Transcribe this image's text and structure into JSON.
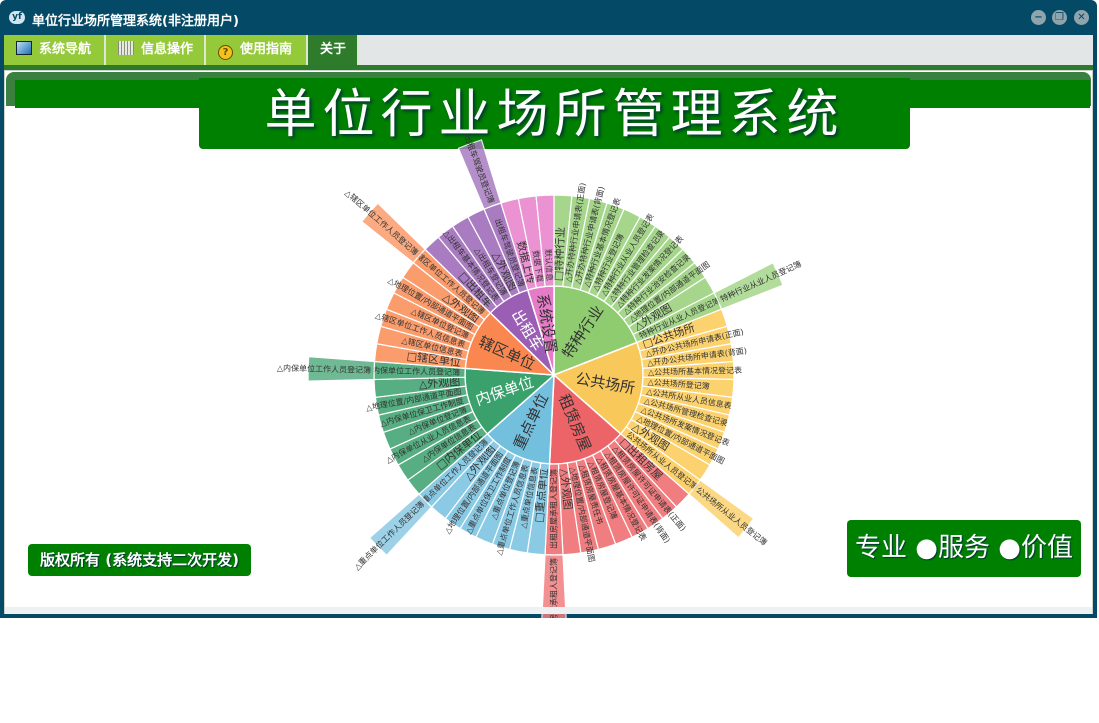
{
  "window": {
    "title": "单位行业场所管理系统(非注册用户)",
    "logo": "yf"
  },
  "menu": [
    {
      "label": "系统导航",
      "icon": "monitor-icon"
    },
    {
      "label": "信息操作",
      "icon": "grid-icon"
    },
    {
      "label": "使用指南",
      "icon": "help-icon"
    },
    {
      "label": "关于",
      "icon": ""
    }
  ],
  "banner": {
    "title": "单位行业场所管理系统"
  },
  "footer": {
    "copyright": "版权所有 (系统支持二次开发)",
    "motto": "专业 ●服务 ●价值"
  },
  "sunburst": [
    {
      "name": "特种行业",
      "color": "#8fcb6f",
      "leaf": "#a5d68b",
      "children": [
        {
          "label": "□特种行业"
        },
        {
          "label": "△开办特种行业申请表(正面)"
        },
        {
          "label": "△开办特种行业申请表(背面)"
        },
        {
          "label": "△特种行业基本情况登记表"
        },
        {
          "label": "△特种行业登记簿"
        },
        {
          "label": "△特种行业从业人员登记表"
        },
        {
          "label": "△特种行业管理检查记录"
        },
        {
          "label": "△特种行业发案情况登记表"
        },
        {
          "label": "△特种行业治安检查记录"
        },
        {
          "label": "△地理位置/内部通道平面图"
        },
        {
          "label": "△外观图"
        },
        {
          "label": "特种行业从业人员登记簿",
          "ext": "特种行业从业人员登记簿"
        }
      ]
    },
    {
      "name": "公共场所",
      "color": "#f9c85a",
      "leaf": "#fbd26e",
      "children": [
        {
          "label": "□公共场所"
        },
        {
          "label": "△开办公共场所申请表(正面)"
        },
        {
          "label": "△开办公共场所申请表(背面)"
        },
        {
          "label": "△公共场所基本情况登记表"
        },
        {
          "label": "△公共场所登记簿"
        },
        {
          "label": "△公共所从业人员信息表"
        },
        {
          "label": "△公共场所管理检查记录"
        },
        {
          "label": "△公共场所发案情况登记表"
        },
        {
          "label": "△地理位置/内部通道平面图"
        },
        {
          "label": "△外观图"
        },
        {
          "label": "公共场所从业人员登记簿",
          "ext": "公共场所从业人员登记簿"
        }
      ]
    },
    {
      "name": "租赁房屋",
      "color": "#ec6467",
      "leaf": "#f07d7f",
      "children": [
        {
          "label": "□出租房屋"
        },
        {
          "label": "△租赁房屋许可证申请表(正面)"
        },
        {
          "label": "△租赁房屋许可证申请表(背面)"
        },
        {
          "label": "△租赁房屋基本情况登记表"
        },
        {
          "label": "△租赁房屋登记簿"
        },
        {
          "label": "△租赁房屋责任书"
        },
        {
          "label": "△地理位置/内部通道平面图"
        },
        {
          "label": "△外观图"
        },
        {
          "label": "出租房屋承租人登记簿",
          "ext": "出租房屋承租人登记簿"
        }
      ]
    },
    {
      "name": "重点单位",
      "color": "#72bfde",
      "leaf": "#8bcae4",
      "children": [
        {
          "label": "□重点单位"
        },
        {
          "label": "△重点单位信息表"
        },
        {
          "label": "△重点单位工作人员信息表"
        },
        {
          "label": "△重点单位登记簿"
        },
        {
          "label": "△重点单位保卫工作制度"
        },
        {
          "label": "△地理位置/内部通道平面图"
        },
        {
          "label": "△外观图"
        },
        {
          "label": "重点单位工作人员登记簿",
          "ext": "△重点单位工作人员登记簿"
        }
      ]
    },
    {
      "name": "内保单位",
      "color": "#3aa16d",
      "leaf": "#56ae82",
      "children": [
        {
          "label": "□内保单位"
        },
        {
          "label": "△内保单位信息表"
        },
        {
          "label": "△内保单位从业人员信息表"
        },
        {
          "label": "△内保单位登记簿"
        },
        {
          "label": "△内保单位保卫工作制度"
        },
        {
          "label": "△地理位置/内部通道平面图"
        },
        {
          "label": "△外观图"
        },
        {
          "label": "内保单位工作人员登记簿",
          "ext": "△内保单位工作人员登记簿"
        }
      ]
    },
    {
      "name": "辖区单位",
      "color": "#fa8750",
      "leaf": "#fb9c6c",
      "children": [
        {
          "label": "□辖区单位"
        },
        {
          "label": "△辖区单位信息表"
        },
        {
          "label": "△辖区单位工作人员信息表"
        },
        {
          "label": "△辖区单位登记簿"
        },
        {
          "label": "△地理位置/内部通道平面图"
        },
        {
          "label": "△外观图"
        },
        {
          "label": "辖区单位工作人员登记簿",
          "ext": "△辖区单位工作人员登记簿"
        }
      ]
    },
    {
      "name": "出租车",
      "color": "#9a5fb4",
      "leaf": "#a97cc1",
      "children": [
        {
          "label": "□出租车"
        },
        {
          "label": "△出租车基本情况登记表"
        },
        {
          "label": "△出租车登记簿"
        },
        {
          "label": "△外观图"
        },
        {
          "label": "出租车驾驶员登记簿",
          "ext": "出租车驾驶员登记簿"
        }
      ]
    },
    {
      "name": "系统设置",
      "color": "#e67cc8",
      "leaf": "#eb92d3",
      "children": [
        {
          "label": "数据上传"
        },
        {
          "label": "数据下载"
        },
        {
          "label": "默认信息"
        }
      ]
    }
  ]
}
